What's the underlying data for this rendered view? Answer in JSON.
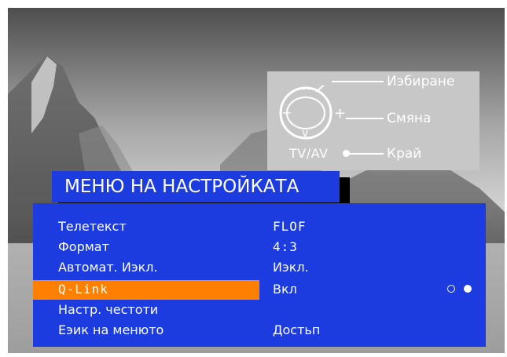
{
  "hint_panel": {
    "select_label": "Иэбиране",
    "change_label": "Смяна",
    "exit_label": "Край",
    "tvav_label": "TV/AV",
    "pad_symbols": {
      "up": "^",
      "down": "v",
      "left": "−",
      "right": "+"
    }
  },
  "menu": {
    "title": "МЕНЮ НА НАСТРОЙКАТА",
    "items": [
      {
        "label": "Телетекст",
        "value": "FLOF"
      },
      {
        "label": "Формат",
        "value": "4:3"
      },
      {
        "label": "Автомат. Иэкл.",
        "value": "Иэкл."
      },
      {
        "label": "Q-Link",
        "value": "Вкл",
        "selected": true,
        "options": [
          "off",
          "on"
        ]
      },
      {
        "label": "Настр. честоти",
        "value": ""
      },
      {
        "label": "Еэик на менюто",
        "value": "Достьп"
      }
    ]
  },
  "colors": {
    "menu_bg": "#1c3ce0",
    "highlight": "#ff8000",
    "hint_bg": "#c7c7c7",
    "text": "#ffffff"
  }
}
